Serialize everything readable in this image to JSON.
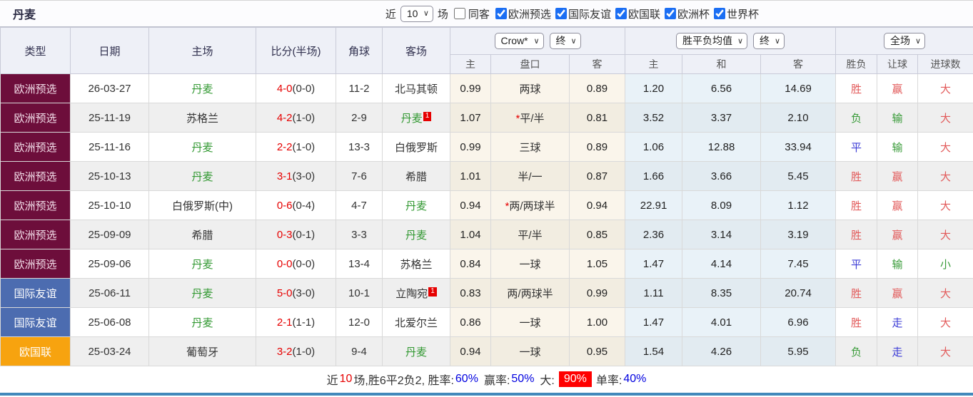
{
  "title": "丹麦",
  "controls": {
    "near_label": "近",
    "near_value": "10",
    "games_label": "场",
    "same_away_label": "同客",
    "filters": [
      {
        "label": "欧洲预选",
        "checked": "checked"
      },
      {
        "label": "国际友谊",
        "checked": "checked"
      },
      {
        "label": "欧国联",
        "checked": "checked"
      },
      {
        "label": "欧洲杯",
        "checked": "checked"
      },
      {
        "label": "世界杯",
        "checked": "checked"
      }
    ],
    "accent_color": "#1b6ef3"
  },
  "table": {
    "columns": [
      "类型",
      "日期",
      "主场",
      "比分(半场)",
      "角球",
      "客场"
    ],
    "dropdowns": {
      "company": "Crow*",
      "company_state": "终",
      "odds_avg": "胜平负均值",
      "odds_state": "终",
      "scope": "全场"
    },
    "subheaders": [
      "主",
      "盘口",
      "客",
      "主",
      "和",
      "客",
      "胜负",
      "让球",
      "进球数"
    ]
  },
  "type_colors": {
    "maroon": "#6d0e3b",
    "blue": "#4c6cb0",
    "orange": "#f7a30f"
  },
  "rows": [
    {
      "type": "欧洲预选",
      "type_class": "t-maroon",
      "date": "26-03-27",
      "home": "丹麦",
      "home_class": "team-green",
      "score": "4-0",
      "half": "(0-0)",
      "corner": "11-2",
      "away": "北马其顿",
      "away_class": "",
      "badge": "1",
      "badge_class": "off",
      "h_odds": "0.99",
      "star": "",
      "handicap": "两球",
      "a_odds": "0.89",
      "win": "1.20",
      "draw": "6.56",
      "lose": "14.69",
      "wdl": "胜",
      "wdl_class": "red",
      "let": "赢",
      "let_class": "red",
      "goals": "大",
      "goals_class": "red"
    },
    {
      "type": "欧洲预选",
      "type_class": "t-maroon",
      "date": "25-11-19",
      "home": "苏格兰",
      "home_class": "",
      "score": "4-2",
      "half": "(1-0)",
      "corner": "2-9",
      "away": "丹麦",
      "away_class": "team-green",
      "badge": "1",
      "badge_class": "on",
      "h_odds": "1.07",
      "star": "*",
      "handicap": "平/半",
      "a_odds": "0.81",
      "win": "3.52",
      "draw": "3.37",
      "lose": "2.10",
      "wdl": "负",
      "wdl_class": "green",
      "let": "输",
      "let_class": "green",
      "goals": "大",
      "goals_class": "red"
    },
    {
      "type": "欧洲预选",
      "type_class": "t-maroon",
      "date": "25-11-16",
      "home": "丹麦",
      "home_class": "team-green",
      "score": "2-2",
      "half": "(1-0)",
      "corner": "13-3",
      "away": "白俄罗斯",
      "away_class": "",
      "badge": "1",
      "badge_class": "off",
      "h_odds": "0.99",
      "star": "",
      "handicap": "三球",
      "a_odds": "0.89",
      "win": "1.06",
      "draw": "12.88",
      "lose": "33.94",
      "wdl": "平",
      "wdl_class": "blue",
      "let": "输",
      "let_class": "green",
      "goals": "大",
      "goals_class": "red"
    },
    {
      "type": "欧洲预选",
      "type_class": "t-maroon",
      "date": "25-10-13",
      "home": "丹麦",
      "home_class": "team-green",
      "score": "3-1",
      "half": "(3-0)",
      "corner": "7-6",
      "away": "希腊",
      "away_class": "",
      "badge": "1",
      "badge_class": "off",
      "h_odds": "1.01",
      "star": "",
      "handicap": "半/一",
      "a_odds": "0.87",
      "win": "1.66",
      "draw": "3.66",
      "lose": "5.45",
      "wdl": "胜",
      "wdl_class": "red",
      "let": "赢",
      "let_class": "red",
      "goals": "大",
      "goals_class": "red"
    },
    {
      "type": "欧洲预选",
      "type_class": "t-maroon",
      "date": "25-10-10",
      "home": "白俄罗斯(中)",
      "home_class": "",
      "score": "0-6",
      "half": "(0-4)",
      "corner": "4-7",
      "away": "丹麦",
      "away_class": "team-green",
      "badge": "1",
      "badge_class": "off",
      "h_odds": "0.94",
      "star": "*",
      "handicap": "两/两球半",
      "a_odds": "0.94",
      "win": "22.91",
      "draw": "8.09",
      "lose": "1.12",
      "wdl": "胜",
      "wdl_class": "red",
      "let": "赢",
      "let_class": "red",
      "goals": "大",
      "goals_class": "red"
    },
    {
      "type": "欧洲预选",
      "type_class": "t-maroon",
      "date": "25-09-09",
      "home": "希腊",
      "home_class": "",
      "score": "0-3",
      "half": "(0-1)",
      "corner": "3-3",
      "away": "丹麦",
      "away_class": "team-green",
      "badge": "1",
      "badge_class": "off",
      "h_odds": "1.04",
      "star": "",
      "handicap": "平/半",
      "a_odds": "0.85",
      "win": "2.36",
      "draw": "3.14",
      "lose": "3.19",
      "wdl": "胜",
      "wdl_class": "red",
      "let": "赢",
      "let_class": "red",
      "goals": "大",
      "goals_class": "red"
    },
    {
      "type": "欧洲预选",
      "type_class": "t-maroon",
      "date": "25-09-06",
      "home": "丹麦",
      "home_class": "team-green",
      "score": "0-0",
      "half": "(0-0)",
      "corner": "13-4",
      "away": "苏格兰",
      "away_class": "",
      "badge": "1",
      "badge_class": "off",
      "h_odds": "0.84",
      "star": "",
      "handicap": "一球",
      "a_odds": "1.05",
      "win": "1.47",
      "draw": "4.14",
      "lose": "7.45",
      "wdl": "平",
      "wdl_class": "blue",
      "let": "输",
      "let_class": "green",
      "goals": "小",
      "goals_class": "green"
    },
    {
      "type": "国际友谊",
      "type_class": "t-blue",
      "date": "25-06-11",
      "home": "丹麦",
      "home_class": "team-green",
      "score": "5-0",
      "half": "(3-0)",
      "corner": "10-1",
      "away": "立陶宛",
      "away_class": "",
      "badge": "1",
      "badge_class": "on",
      "h_odds": "0.83",
      "star": "",
      "handicap": "两/两球半",
      "a_odds": "0.99",
      "win": "1.11",
      "draw": "8.35",
      "lose": "20.74",
      "wdl": "胜",
      "wdl_class": "red",
      "let": "赢",
      "let_class": "red",
      "goals": "大",
      "goals_class": "red"
    },
    {
      "type": "国际友谊",
      "type_class": "t-blue",
      "date": "25-06-08",
      "home": "丹麦",
      "home_class": "team-green",
      "score": "2-1",
      "half": "(1-1)",
      "corner": "12-0",
      "away": "北爱尔兰",
      "away_class": "",
      "badge": "1",
      "badge_class": "off",
      "h_odds": "0.86",
      "star": "",
      "handicap": "一球",
      "a_odds": "1.00",
      "win": "1.47",
      "draw": "4.01",
      "lose": "6.96",
      "wdl": "胜",
      "wdl_class": "red",
      "let": "走",
      "let_class": "blue",
      "goals": "大",
      "goals_class": "red"
    },
    {
      "type": "欧国联",
      "type_class": "t-orange",
      "date": "25-03-24",
      "home": "葡萄牙",
      "home_class": "",
      "score": "3-2",
      "half": "(1-0)",
      "corner": "9-4",
      "away": "丹麦",
      "away_class": "team-green",
      "badge": "1",
      "badge_class": "off",
      "h_odds": "0.94",
      "star": "",
      "handicap": "一球",
      "a_odds": "0.95",
      "win": "1.54",
      "draw": "4.26",
      "lose": "5.95",
      "wdl": "负",
      "wdl_class": "green",
      "let": "走",
      "let_class": "blue",
      "goals": "大",
      "goals_class": "red"
    }
  ],
  "footer": {
    "p1": "近",
    "count": "10",
    "p2": "场,胜6平2负2, 胜率:",
    "win_rate": "60%",
    "p3": "赢率:",
    "handicap_rate": "50%",
    "p4": "大:",
    "big_rate": "90%",
    "p5": "单率:",
    "single_rate": "40%",
    "big_rate_bg": "#ff0000"
  }
}
